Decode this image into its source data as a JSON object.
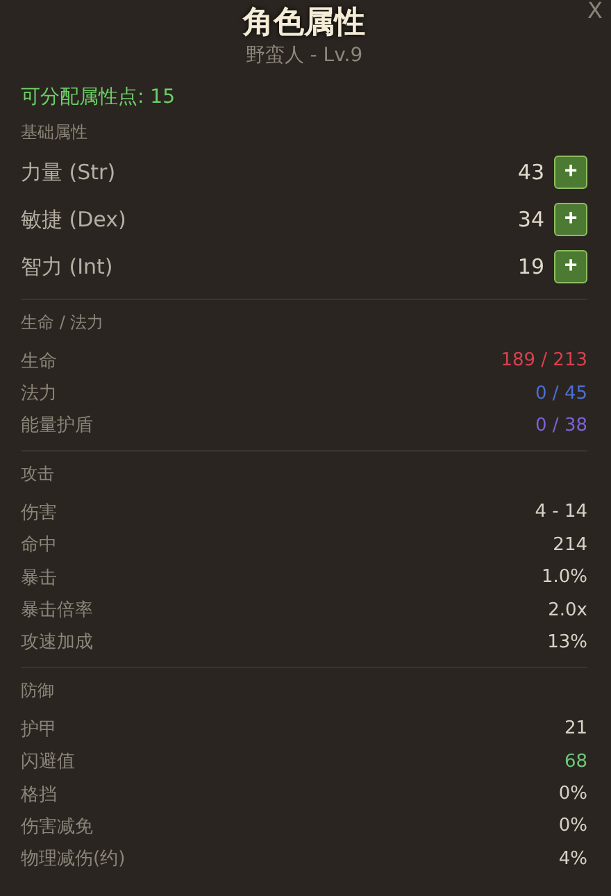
{
  "title": "角色属性",
  "subtitle": "野蛮人 - Lv.9",
  "close": "X",
  "points": "可分配属性点: 15",
  "base": {
    "heading": "基础属性",
    "attributes": [
      {
        "name": "力量 (Str)",
        "value": "43",
        "button": "+"
      },
      {
        "name": "敏捷 (Dex)",
        "value": "34",
        "button": "+"
      },
      {
        "name": "智力 (Int)",
        "value": "19",
        "button": "+"
      }
    ]
  },
  "sections": [
    {
      "heading": "生命 / 法力",
      "stats": [
        {
          "label": "生命",
          "value": "189 / 213",
          "color": "#d9404e"
        },
        {
          "label": "法力",
          "value": "0 / 45",
          "color": "#4a6fd8"
        },
        {
          "label": "能量护盾",
          "value": "0 / 38",
          "color": "#7a62d6"
        }
      ]
    },
    {
      "heading": "攻击",
      "stats": [
        {
          "label": "伤害",
          "value": "4 - 14",
          "color": "#d8d2c6"
        },
        {
          "label": "命中",
          "value": "214",
          "color": "#d8d2c6"
        },
        {
          "label": "暴击",
          "value": "1.0%",
          "color": "#d8d2c6"
        },
        {
          "label": "暴击倍率",
          "value": "2.0x",
          "color": "#d8d2c6"
        },
        {
          "label": "攻速加成",
          "value": "13%",
          "color": "#d8d2c6"
        }
      ]
    },
    {
      "heading": "防御",
      "stats": [
        {
          "label": "护甲",
          "value": "21",
          "color": "#d8d2c6"
        },
        {
          "label": "闪避值",
          "value": "68",
          "color": "#6ec77a"
        },
        {
          "label": "格挡",
          "value": "0%",
          "color": "#d8d2c6"
        },
        {
          "label": "伤害减免",
          "value": "0%",
          "color": "#d8d2c6"
        },
        {
          "label": "物理减伤(约)",
          "value": "4%",
          "color": "#d8d2c6"
        }
      ]
    }
  ]
}
